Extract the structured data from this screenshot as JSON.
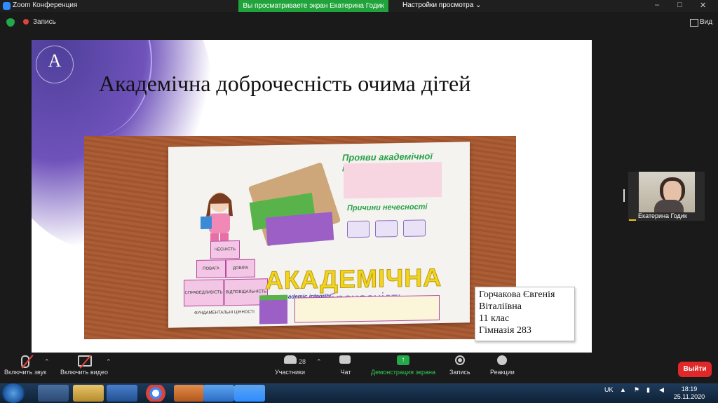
{
  "window": {
    "title": "Zoom Конференция",
    "controls": [
      "–",
      "□",
      "✕"
    ]
  },
  "share_banner": {
    "text": "Вы просматриваете экран Екатерина Годик"
  },
  "view_options": {
    "label": "Настройки просмотра ⌄"
  },
  "topbar": {
    "record_label": "Запись",
    "view_label": "Вид"
  },
  "slide": {
    "title": "Академічна доброчесність очима дітей",
    "logo_letter": "А",
    "poster": {
      "big_word": "АКАДЕМІЧНА",
      "small_word": "academic integrity",
      "purple_word": "доброчесність",
      "green_heading": "Прояви академічної нечесності",
      "green_heading2": "Причини нечесності",
      "pyramid": [
        "ЧЕСНІСТЬ",
        "ПОВАГА",
        "ДОВІРА",
        "СПРАВЕДЛИВІСТЬ",
        "ВІДПОВІДАЛЬНІСТЬ",
        "ФУНДАМЕНТАЛЬНІ ЦІННОСТІ"
      ]
    },
    "caption": {
      "line1": "Горчакова Євгенія",
      "line2": "Віталіївна",
      "line3": "11 клас",
      "line4": "Гімназія 283"
    }
  },
  "participant": {
    "name": "Екатерина Годик"
  },
  "toolbar": {
    "mute_label": "Включить звук",
    "video_label": "Включить видео",
    "participants_label": "Участники",
    "participants_count": "28",
    "chat_label": "Чат",
    "share_label": "Демонстрация экрана",
    "record_label": "Запись",
    "reactions_label": "Реакции",
    "leave_label": "Выйти"
  },
  "taskbar": {
    "lang": "UK",
    "time": "18:19",
    "date": "25.11.2020"
  },
  "colors": {
    "share_green": "#20a33a",
    "leave_red": "#e02828",
    "toolbar_bg": "#1a1a1a"
  }
}
